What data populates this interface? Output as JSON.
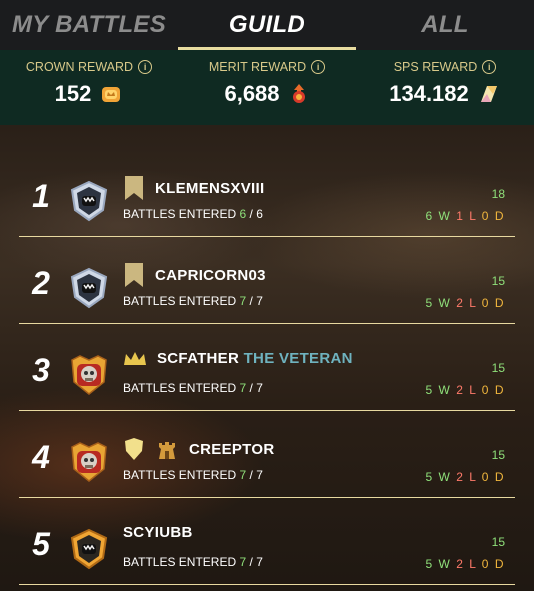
{
  "tabs": [
    {
      "label": "MY BATTLES",
      "active": false
    },
    {
      "label": "GUILD",
      "active": true
    },
    {
      "label": "ALL",
      "active": false
    }
  ],
  "rewards": [
    {
      "label": "CROWN REWARD",
      "value": "152",
      "icon": "crown-token-icon"
    },
    {
      "label": "MERIT REWARD",
      "value": "6,688",
      "icon": "merit-icon"
    },
    {
      "label": "SPS REWARD",
      "value": "134.182",
      "icon": "sps-crystal-icon"
    }
  ],
  "rows": [
    {
      "rank": "1",
      "name": "KLEMENSXVIII",
      "title": "",
      "rank_icon": "bookmark-icon",
      "extra_icon": "",
      "avatar": "bronze-shield-avatar",
      "battles_label": "BATTLES ENTERED",
      "entered": "6",
      "sep": " / ",
      "total": "6",
      "score": "18",
      "w": "6",
      "l": "1",
      "d": "0"
    },
    {
      "rank": "2",
      "name": "CAPRICORN03",
      "title": "",
      "rank_icon": "bookmark-icon",
      "extra_icon": "",
      "avatar": "bronze-shield-avatar",
      "battles_label": "BATTLES ENTERED",
      "entered": "7",
      "sep": " / ",
      "total": "7",
      "score": "15",
      "w": "5",
      "l": "2",
      "d": "0"
    },
    {
      "rank": "3",
      "name": "SCFATHER",
      "title": "THE VETERAN",
      "rank_icon": "crown-icon",
      "extra_icon": "",
      "avatar": "gold-skull-avatar",
      "battles_label": "BATTLES ENTERED",
      "entered": "7",
      "sep": " / ",
      "total": "7",
      "score": "15",
      "w": "5",
      "l": "2",
      "d": "0"
    },
    {
      "rank": "4",
      "name": "CREEPTOR",
      "title": "",
      "rank_icon": "shield-icon",
      "extra_icon": "tower-icon",
      "avatar": "gold-skull-avatar",
      "battles_label": "BATTLES ENTERED",
      "entered": "7",
      "sep": " / ",
      "total": "7",
      "score": "15",
      "w": "5",
      "l": "2",
      "d": "0"
    },
    {
      "rank": "5",
      "name": "SCYIUBB",
      "title": "",
      "rank_icon": "",
      "extra_icon": "",
      "avatar": "gold-shield-avatar",
      "battles_label": "BATTLES ENTERED",
      "entered": "7",
      "sep": " / ",
      "total": "7",
      "score": "15",
      "w": "5",
      "l": "2",
      "d": "0"
    }
  ],
  "wld_letters": {
    "w": "W",
    "l": "L",
    "d": "D"
  }
}
